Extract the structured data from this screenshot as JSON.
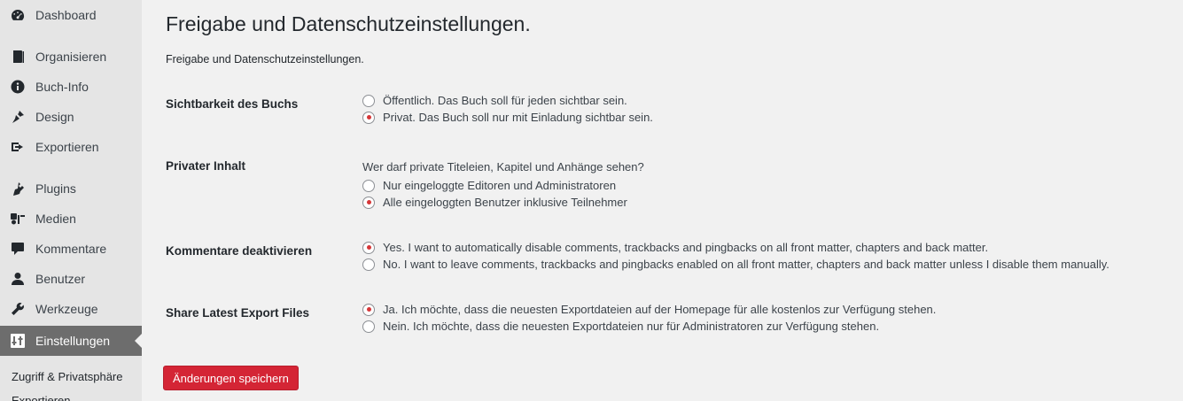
{
  "sidebar": {
    "items": [
      {
        "label": "Dashboard",
        "icon": "dashboard-icon"
      },
      {
        "label": "Organisieren",
        "icon": "book-icon"
      },
      {
        "label": "Buch-Info",
        "icon": "info-icon"
      },
      {
        "label": "Design",
        "icon": "brush-icon"
      },
      {
        "label": "Exportieren",
        "icon": "export-icon"
      },
      {
        "label": "Plugins",
        "icon": "plugin-icon"
      },
      {
        "label": "Medien",
        "icon": "media-icon"
      },
      {
        "label": "Kommentare",
        "icon": "comment-icon"
      },
      {
        "label": "Benutzer",
        "icon": "users-icon"
      },
      {
        "label": "Werkzeuge",
        "icon": "wrench-icon"
      },
      {
        "label": "Einstellungen",
        "icon": "settings-icon"
      }
    ],
    "submenu": [
      {
        "label": "Zugriff & Privatsphäre"
      },
      {
        "label": "Exportieren"
      }
    ]
  },
  "main": {
    "title": "Freigabe und Datenschutzeinstellungen.",
    "description": "Freigabe und Datenschutzeinstellungen.",
    "sections": [
      {
        "label": "Sichtbarkeit des Buchs",
        "options": [
          {
            "text": "Öffentlich. Das Buch soll für jeden sichtbar sein.",
            "checked": false
          },
          {
            "text": "Privat. Das Buch soll nur mit Einladung sichtbar sein.",
            "checked": true
          }
        ]
      },
      {
        "label": "Privater Inhalt",
        "question": "Wer darf private Titeleien, Kapitel und Anhänge sehen?",
        "options": [
          {
            "text": "Nur eingeloggte Editoren und Administratoren",
            "checked": false
          },
          {
            "text": "Alle eingeloggten Benutzer inklusive Teilnehmer",
            "checked": true
          }
        ]
      },
      {
        "label": "Kommentare deaktivieren",
        "options": [
          {
            "text": "Yes. I want to automatically disable comments, trackbacks and pingbacks on all front matter, chapters and back matter.",
            "checked": true
          },
          {
            "text": "No. I want to leave comments, trackbacks and pingbacks enabled on all front matter, chapters and back matter unless I disable them manually.",
            "checked": false
          }
        ]
      },
      {
        "label": "Share Latest Export Files",
        "options": [
          {
            "text": "Ja. Ich möchte, dass die neuesten Exportdateien auf der Homepage für alle kostenlos zur Verfügung stehen.",
            "checked": true
          },
          {
            "text": "Nein. Ich möchte, dass die neuesten Exportdateien nur für Administratoren zur Verfügung stehen.",
            "checked": false
          }
        ]
      }
    ],
    "save_label": "Änderungen speichern"
  },
  "colors": {
    "accent": "#d63638",
    "button": "#d42535",
    "sidebar_bg": "#e5e5e5",
    "active_bg": "#6d6d6d",
    "page_bg": "#f1f1f1"
  }
}
